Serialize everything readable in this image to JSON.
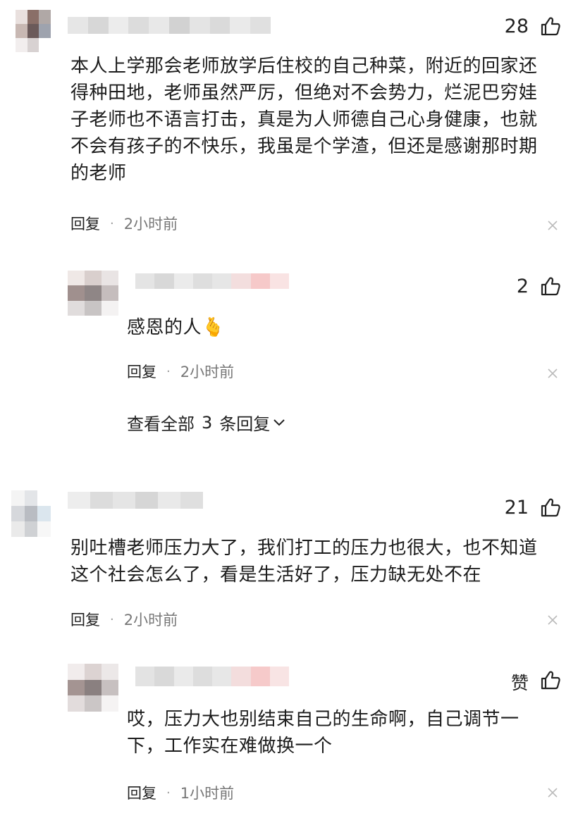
{
  "comments": [
    {
      "likes": "28",
      "text_lines": [
        "本人上学那会老师放学后住校的自己种菜，附近的回家还",
        "得种田地，老师虽然严厉，但绝对不会势力，烂泥巴穷娃",
        "子老师也不语言打击，真是为人师德自己心身健康，也就",
        "不会有孩子的不快乐，我虽是个学渣，但还是感谢那时期",
        "的老师"
      ],
      "reply_label": "回复",
      "dot": "·",
      "time": "2小时前",
      "reply": {
        "likes": "2",
        "text": "感恩的人",
        "emoji": "🫰",
        "reply_label": "回复",
        "dot": "·",
        "time": "2小时前"
      },
      "view_all": {
        "prefix": "查看全部",
        "count": "3",
        "suffix": "条回复",
        "chevron": "chevron-down-icon"
      }
    },
    {
      "likes": "21",
      "text_lines": [
        "别吐槽老师压力大了，我们打工的压力也很大，也不知道",
        "这个社会怎么了，看是生活好了，压力缺无处不在"
      ],
      "reply_label": "回复",
      "dot": "·",
      "time": "2小时前",
      "reply": {
        "likes": "赞",
        "text_lines": [
          "哎，压力大也别结束自己的生命啊，自己调节一",
          "下，工作实在难做换一个"
        ],
        "reply_label": "回复",
        "dot": "·",
        "time": "1小时前"
      }
    }
  ],
  "icons": {
    "like": "thumbs-up-icon",
    "close": "close-icon",
    "avatar": "avatar"
  },
  "colors": {
    "text": "#1c1c1c",
    "meta_time": "#777777",
    "close": "#bbbbbb"
  }
}
